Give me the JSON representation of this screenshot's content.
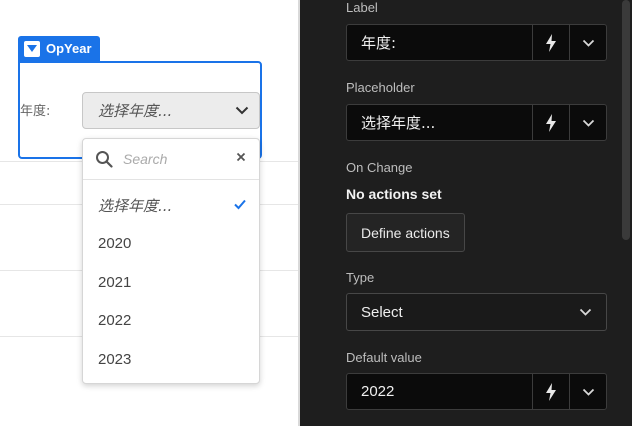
{
  "canvas": {
    "widget_name": "OpYear",
    "field_label": "年度:",
    "select_placeholder": "选择年度...",
    "dropdown": {
      "search_placeholder": "Search",
      "options": [
        {
          "label": "选择年度...",
          "selected": true
        },
        {
          "label": "2020",
          "selected": false
        },
        {
          "label": "2021",
          "selected": false
        },
        {
          "label": "2022",
          "selected": false
        },
        {
          "label": "2023",
          "selected": false
        }
      ]
    }
  },
  "panel": {
    "label_title": "Label",
    "label_value": "年度:",
    "placeholder_title": "Placeholder",
    "placeholder_value": "选择年度...",
    "on_change_title": "On Change",
    "on_change_status": "No actions set",
    "define_actions_label": "Define actions",
    "type_title": "Type",
    "type_value": "Select",
    "default_value_title": "Default value",
    "default_value": "2022"
  },
  "colors": {
    "accent": "#1a73e8",
    "panel_bg": "#1e1e1e",
    "input_bg": "#0b0b0b"
  },
  "icons": [
    "dropdown-chevron-icon",
    "search-icon",
    "close-icon",
    "check-icon",
    "lightning-icon",
    "chevron-down-icon"
  ]
}
